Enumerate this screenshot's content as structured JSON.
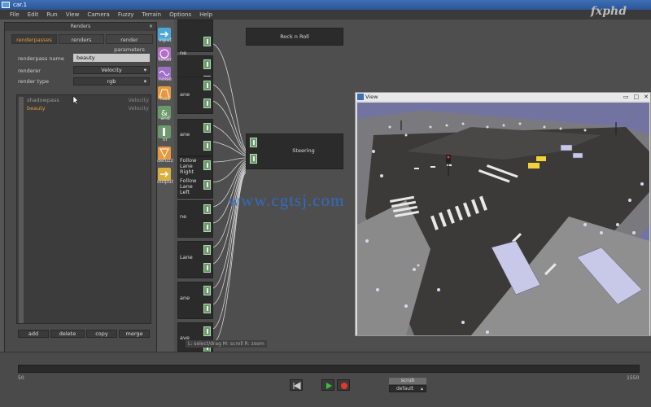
{
  "window": {
    "title": "car.1",
    "logo_text": "fxphd",
    "view_select": "brain"
  },
  "menu": [
    "File",
    "Edit",
    "Run",
    "View",
    "Camera",
    "Fuzzy",
    "Terrain",
    "Options",
    "Help"
  ],
  "renders_panel": {
    "title": "Renders",
    "close": "×",
    "tabs": [
      "renderpasses",
      "renders",
      "render parameters"
    ],
    "active_tab": "renderpasses",
    "fields": {
      "renderpass_name_label": "renderpass name",
      "renderpass_name_value": "beauty",
      "renderer_label": "renderer",
      "renderer_value": "Velocity",
      "render_type_label": "render type",
      "render_type_value": "rgb"
    },
    "passes": [
      {
        "name": "shadowpass",
        "renderer": "Velocity"
      },
      {
        "name": "beauty",
        "renderer": "Velocity"
      }
    ],
    "buttons": {
      "add": "add",
      "delete": "delete",
      "copy": "copy",
      "merge": "merge"
    }
  },
  "tools": [
    {
      "label": "input",
      "icon": "arrow-right-icon",
      "color": "#4aa8d8"
    },
    {
      "label": "timer",
      "icon": "timer-icon",
      "color": "#b070c8"
    },
    {
      "label": "noise",
      "icon": "noise-wave-icon",
      "color": "#a070c8"
    },
    {
      "label": "fuzz",
      "icon": "fuzz-bell-icon",
      "color": "#e8973a"
    },
    {
      "label": "and",
      "icon": "and-icon",
      "color": "#6a9a6a"
    },
    {
      "label": "or",
      "icon": "or-icon",
      "color": "#6a9a6a"
    },
    {
      "label": "defuzz",
      "icon": "defuzz-triangle-icon",
      "color": "#e8973a"
    },
    {
      "label": "output",
      "icon": "arrow-right-icon",
      "color": "#d8b040"
    }
  ],
  "graph": {
    "nodes": {
      "rock_n_roll": "Rock n Roll",
      "steering": "Steering"
    },
    "left_labels": [
      "ne",
      "ane",
      "ane",
      "Follow Lane Right",
      "Follow Lane Left",
      "ne",
      "Lane",
      "ane",
      "ave"
    ],
    "hint": "L: select/drag  M: scroll  R: zoom"
  },
  "view_window": {
    "title": "View"
  },
  "timeline": {
    "start": "50",
    "end": "1550",
    "scrub": "scrub",
    "mode": "default"
  },
  "watermark": "www.cgtsj.com"
}
